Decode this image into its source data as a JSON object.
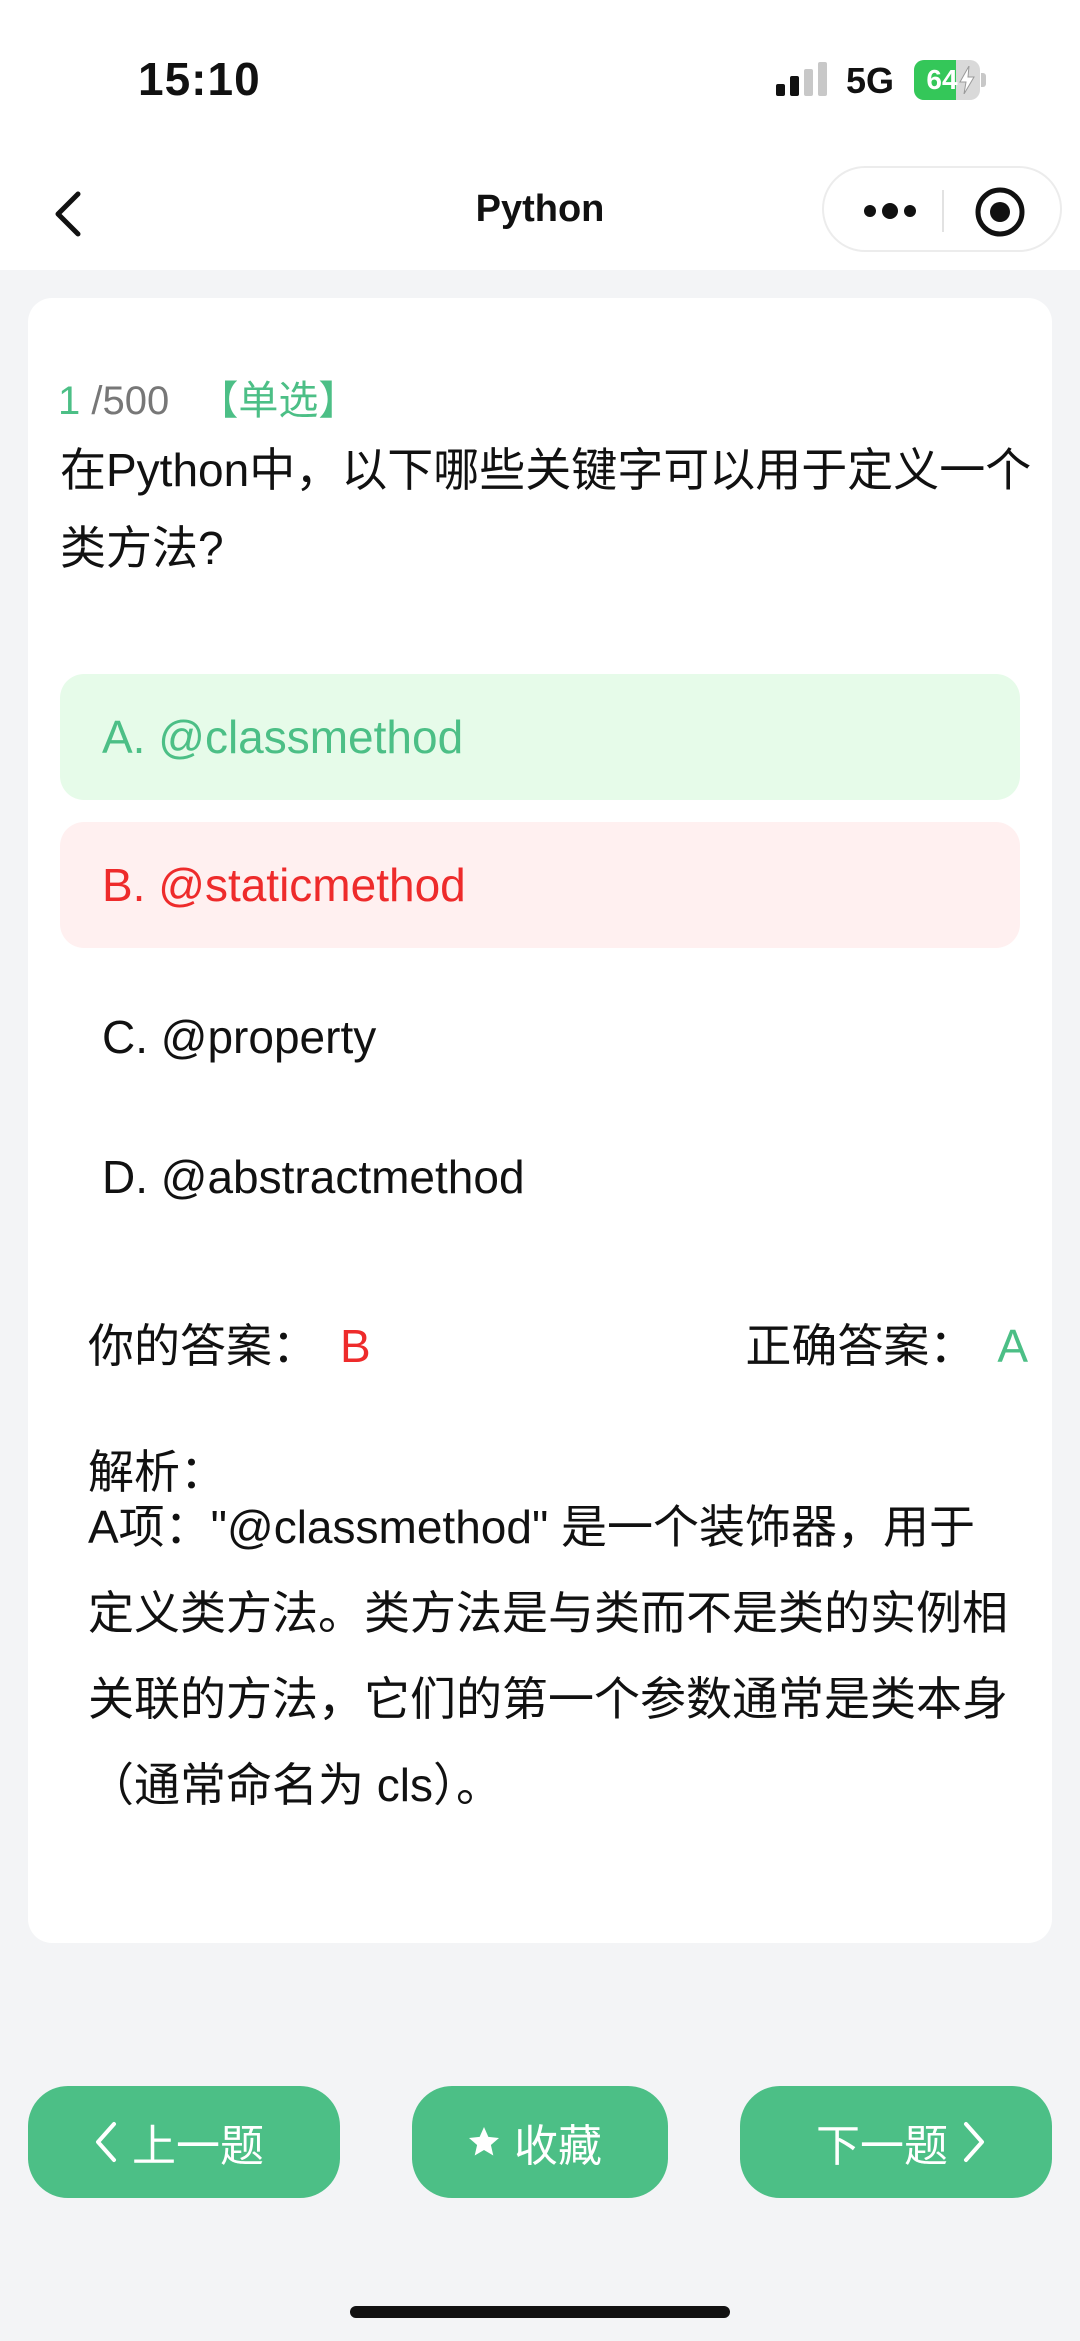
{
  "status_bar": {
    "time": "15:10",
    "network": "5G",
    "battery": "64",
    "battery_level": 0.64
  },
  "nav": {
    "title": "Python"
  },
  "question": {
    "current": "1",
    "total": "/500",
    "type": "【单选】",
    "text": "在Python中，以下哪些关键字可以用于定义一个类方法?",
    "options": [
      {
        "label": "A. @classmethod",
        "state": "correct"
      },
      {
        "label": "B. @staticmethod",
        "state": "wrong"
      },
      {
        "label": "C. @property",
        "state": "none"
      },
      {
        "label": "D. @abstractmethod",
        "state": "none"
      }
    ]
  },
  "result": {
    "your_answer_label": "你的答案：",
    "your_answer": "B",
    "correct_answer_label": "正确答案：",
    "correct_answer": "A"
  },
  "analysis": {
    "label": "解析：",
    "text": "A项：\"@classmethod\" 是一个装饰器，用于定义类方法。类方法是与类而不是类的实例相关联的方法，它们的第一个参数通常是类本身（通常命名为 cls）。"
  },
  "buttons": {
    "prev": "上一题",
    "favorite": "收藏",
    "next": "下一题"
  },
  "colors": {
    "accent": "#4cbf86",
    "correct_bg": "#e6fbe9",
    "wrong": "#ee2b2b",
    "wrong_bg": "#fff0f0",
    "page_bg": "#f3f4f6"
  },
  "icons": {
    "back": "chevron-left-icon",
    "more": "more-dots-icon",
    "close": "target-circle-icon",
    "prev": "chevron-left-icon",
    "favorite": "star-icon",
    "next": "chevron-right-icon"
  }
}
